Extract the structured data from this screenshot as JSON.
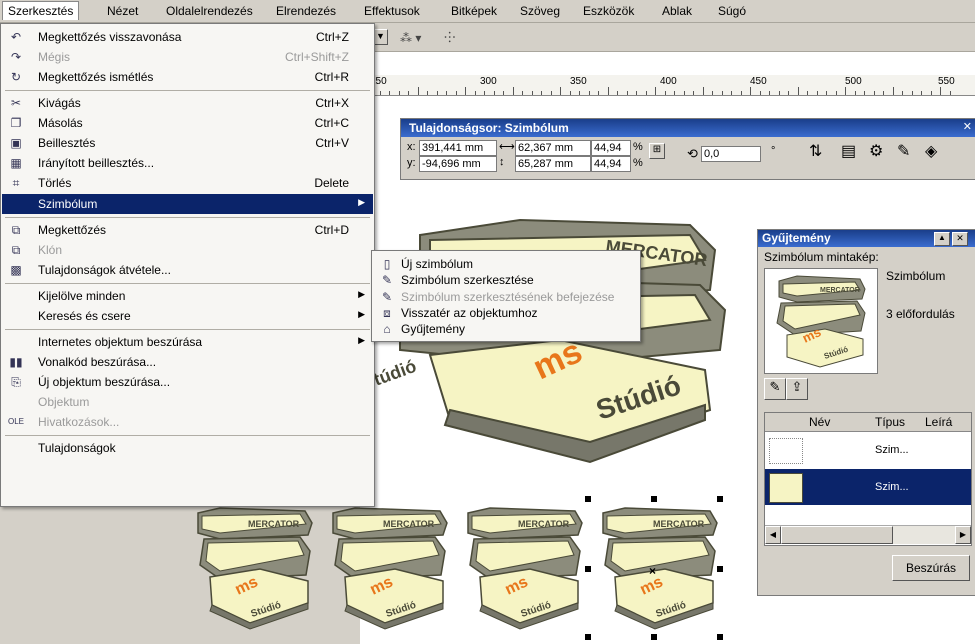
{
  "menubar": {
    "items": [
      "Szerkesztés",
      "Nézet",
      "Oldalelrendezés",
      "Elrendezés",
      "Effektusok",
      "Bitképek",
      "Szöveg",
      "Eszközök",
      "Ablak",
      "Súgó"
    ]
  },
  "ruler": {
    "labels": [
      "250",
      "300",
      "350",
      "400",
      "450",
      "500",
      "550"
    ]
  },
  "edit_menu": {
    "items": [
      {
        "label": "Megkettőzés visszavonása",
        "shortcut": "Ctrl+Z",
        "icon": "undo-icon"
      },
      {
        "label": "Mégis",
        "shortcut": "Ctrl+Shift+Z",
        "icon": "redo-icon",
        "disabled": true
      },
      {
        "label": "Megkettőzés ismétlés",
        "shortcut": "Ctrl+R",
        "icon": "repeat-icon"
      },
      {
        "label": "Kivágás",
        "shortcut": "Ctrl+X",
        "icon": "scissors-icon"
      },
      {
        "label": "Másolás",
        "shortcut": "Ctrl+C",
        "icon": "copy-icon"
      },
      {
        "label": "Beillesztés",
        "shortcut": "Ctrl+V",
        "icon": "paste-icon"
      },
      {
        "label": "Irányított beillesztés...",
        "shortcut": "",
        "icon": "paste-special-icon"
      },
      {
        "label": "Törlés",
        "shortcut": "Delete",
        "icon": "delete-icon"
      },
      {
        "label": "Szimbólum",
        "shortcut": "",
        "icon": "",
        "submenu": true,
        "highlight": true
      },
      {
        "label": "Megkettőzés",
        "shortcut": "Ctrl+D",
        "icon": "duplicate-icon"
      },
      {
        "label": "Klón",
        "shortcut": "",
        "icon": "clone-icon",
        "disabled": true
      },
      {
        "label": "Tulajdonságok átvétele...",
        "shortcut": "",
        "icon": "copy-properties-icon"
      },
      {
        "label": "Kijelölve minden",
        "shortcut": "",
        "submenu": true
      },
      {
        "label": "Keresés és csere",
        "shortcut": "",
        "submenu": true
      },
      {
        "label": "Internetes objektum beszúrása",
        "shortcut": "",
        "submenu": true
      },
      {
        "label": "Vonalkód beszúrása...",
        "shortcut": "",
        "icon": "barcode-icon"
      },
      {
        "label": "Új objektum beszúrása...",
        "shortcut": "",
        "icon": "new-object-icon"
      },
      {
        "label": "Objektum",
        "shortcut": "",
        "disabled": true
      },
      {
        "label": "Hivatkozások...",
        "shortcut": "",
        "icon": "ole-icon",
        "disabled": true
      },
      {
        "label": "Tulajdonságok",
        "shortcut": ""
      }
    ]
  },
  "symbol_submenu": {
    "items": [
      {
        "label": "Új szimbólum",
        "icon": "new-symbol-icon"
      },
      {
        "label": "Szimbólum szerkesztése",
        "icon": "edit-symbol-icon"
      },
      {
        "label": "Szimbólum szerkesztésének befejezése",
        "icon": "finish-edit-symbol-icon",
        "disabled": true
      },
      {
        "label": "Visszatér az objektumhoz",
        "icon": "return-object-icon"
      },
      {
        "label": "Gyűjtemény",
        "icon": "library-icon"
      }
    ]
  },
  "property_bar": {
    "title": "Tulajdonságsor: Szimbólum",
    "x_label": "x:",
    "x_value": "391,441 mm",
    "y_label": "y:",
    "y_value": "-94,696 mm",
    "w_value": "62,367 mm",
    "h_value": "65,287 mm",
    "sx_value": "44,94",
    "sy_value": "44,94",
    "pct": "%",
    "angle_value": "0,0",
    "deg": "°"
  },
  "docker": {
    "title": "Gyűjtemény",
    "preview_label": "Szimbólum mintakép:",
    "symbol_name": "Szimbólum",
    "occurrences": "3 előfordulás",
    "columns": [
      "Név",
      "Típus",
      "Leírá"
    ],
    "rows": [
      {
        "name": "",
        "type": "Szim..."
      },
      {
        "name": "",
        "type": "Szim...",
        "selected": true
      }
    ],
    "insert_button": "Beszúrás"
  },
  "book": {
    "top_text": "MERCATOR",
    "logo": "ms",
    "bottom_text": "Stúdió"
  },
  "colors": {
    "highlight": "#0b246a",
    "book_fill": "#f6f4c4",
    "book_stroke": "#4a4a38",
    "logo": "#e8761a",
    "dark_band": "#77776a"
  }
}
